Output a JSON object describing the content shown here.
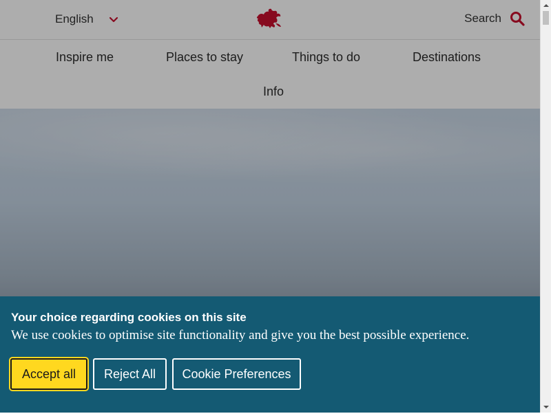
{
  "header": {
    "language": "English",
    "search_label": "Search"
  },
  "nav": {
    "items": [
      {
        "label": "Inspire me"
      },
      {
        "label": "Places to stay"
      },
      {
        "label": "Things to do"
      },
      {
        "label": "Destinations"
      },
      {
        "label": "Info"
      }
    ]
  },
  "cookie_banner": {
    "heading": "Your choice regarding cookies on this site",
    "text": "We use cookies to optimise site functionality and give you the best possible experience.",
    "accept_label": "Accept all",
    "reject_label": "Reject All",
    "preferences_label": "Cookie Preferences"
  },
  "colors": {
    "brand_red": "#c8102e",
    "banner_bg": "#145a73",
    "accept_bg": "#ffd81f"
  },
  "icons": {
    "logo": "welsh-dragon-icon",
    "language_chevron": "chevron-down-icon",
    "search": "search-icon"
  }
}
